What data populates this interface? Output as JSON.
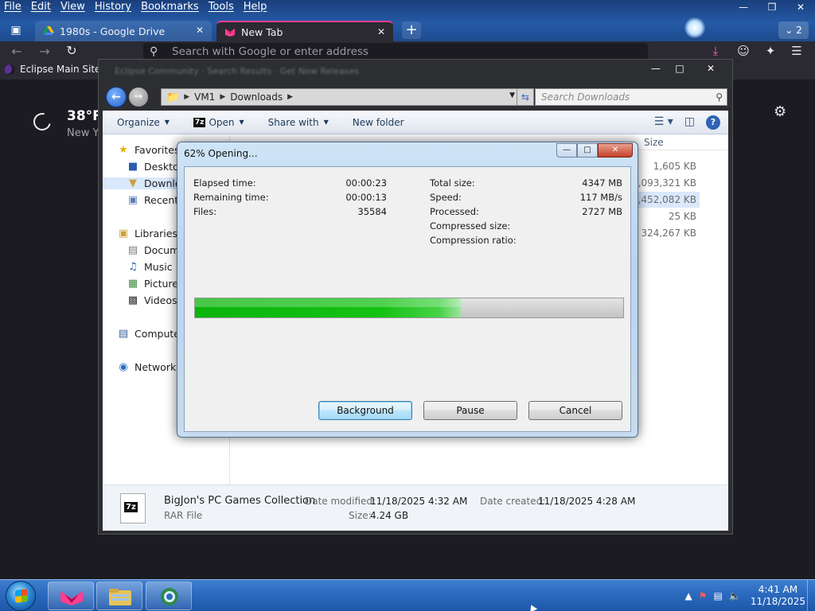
{
  "browser": {
    "menu": [
      "File",
      "Edit",
      "View",
      "History",
      "Bookmarks",
      "Tools",
      "Help"
    ],
    "tabs": [
      {
        "title": "1980s - Google Drive",
        "active": false
      },
      {
        "title": "New Tab",
        "active": true
      }
    ],
    "tab_count": "2",
    "url_placeholder": "Search with Google or enter address",
    "bookmark": "Eclipse Main Site",
    "weather": {
      "temp": "38°F",
      "city": "New Y"
    }
  },
  "explorer": {
    "title_blurred": "Eclipse Community · Search Results · Get New Releases",
    "breadcrumb": [
      "VM1",
      "Downloads"
    ],
    "search_placeholder": "Search Downloads",
    "commands": {
      "organize": "Organize",
      "open": "Open",
      "share": "Share with",
      "new_folder": "New folder"
    },
    "nav": {
      "favorites": "Favorites",
      "desktop": "Desktop",
      "downloads": "Downlo",
      "recent": "Recent P",
      "libraries": "Libraries",
      "documents": "Docum",
      "music": "Music",
      "pictures": "Pictures",
      "videos": "Videos",
      "computer": "Compute",
      "network": "Network"
    },
    "size_header": "Size",
    "sizes": [
      "1,605 KB",
      "1,093,321 KB",
      "4,452,082 KB",
      "25 KB",
      "324,267 KB"
    ],
    "details": {
      "name": "BigJon's PC Games Collection",
      "type": "RAR File",
      "modified_label": "Date modified:",
      "modified": "11/18/2025 4:32 AM",
      "created_label": "Date created:",
      "created": "11/18/2025 4:28 AM",
      "size_label": "Size:",
      "size": "4.24 GB"
    }
  },
  "dialog": {
    "title": "62% Opening...",
    "progress_fraction": 0.62,
    "left": [
      {
        "label": "Elapsed time:",
        "value": "00:00:23"
      },
      {
        "label": "Remaining time:",
        "value": "00:00:13"
      },
      {
        "label": "Files:",
        "value": "35584"
      }
    ],
    "right": [
      {
        "label": "Total size:",
        "value": "4347 MB"
      },
      {
        "label": "Speed:",
        "value": "117 MB/s"
      },
      {
        "label": "Processed:",
        "value": "2727 MB"
      },
      {
        "label": "Compressed size:",
        "value": ""
      },
      {
        "label": "Compression ratio:",
        "value": ""
      }
    ],
    "buttons": {
      "background": "Background",
      "pause": "Pause",
      "cancel": "Cancel"
    }
  },
  "taskbar": {
    "time": "4:41 AM",
    "date": "11/18/2025"
  },
  "colors": {
    "accent": "#ff3f8e",
    "progress": "#14c214",
    "taskbar": "#2d6cc0"
  }
}
